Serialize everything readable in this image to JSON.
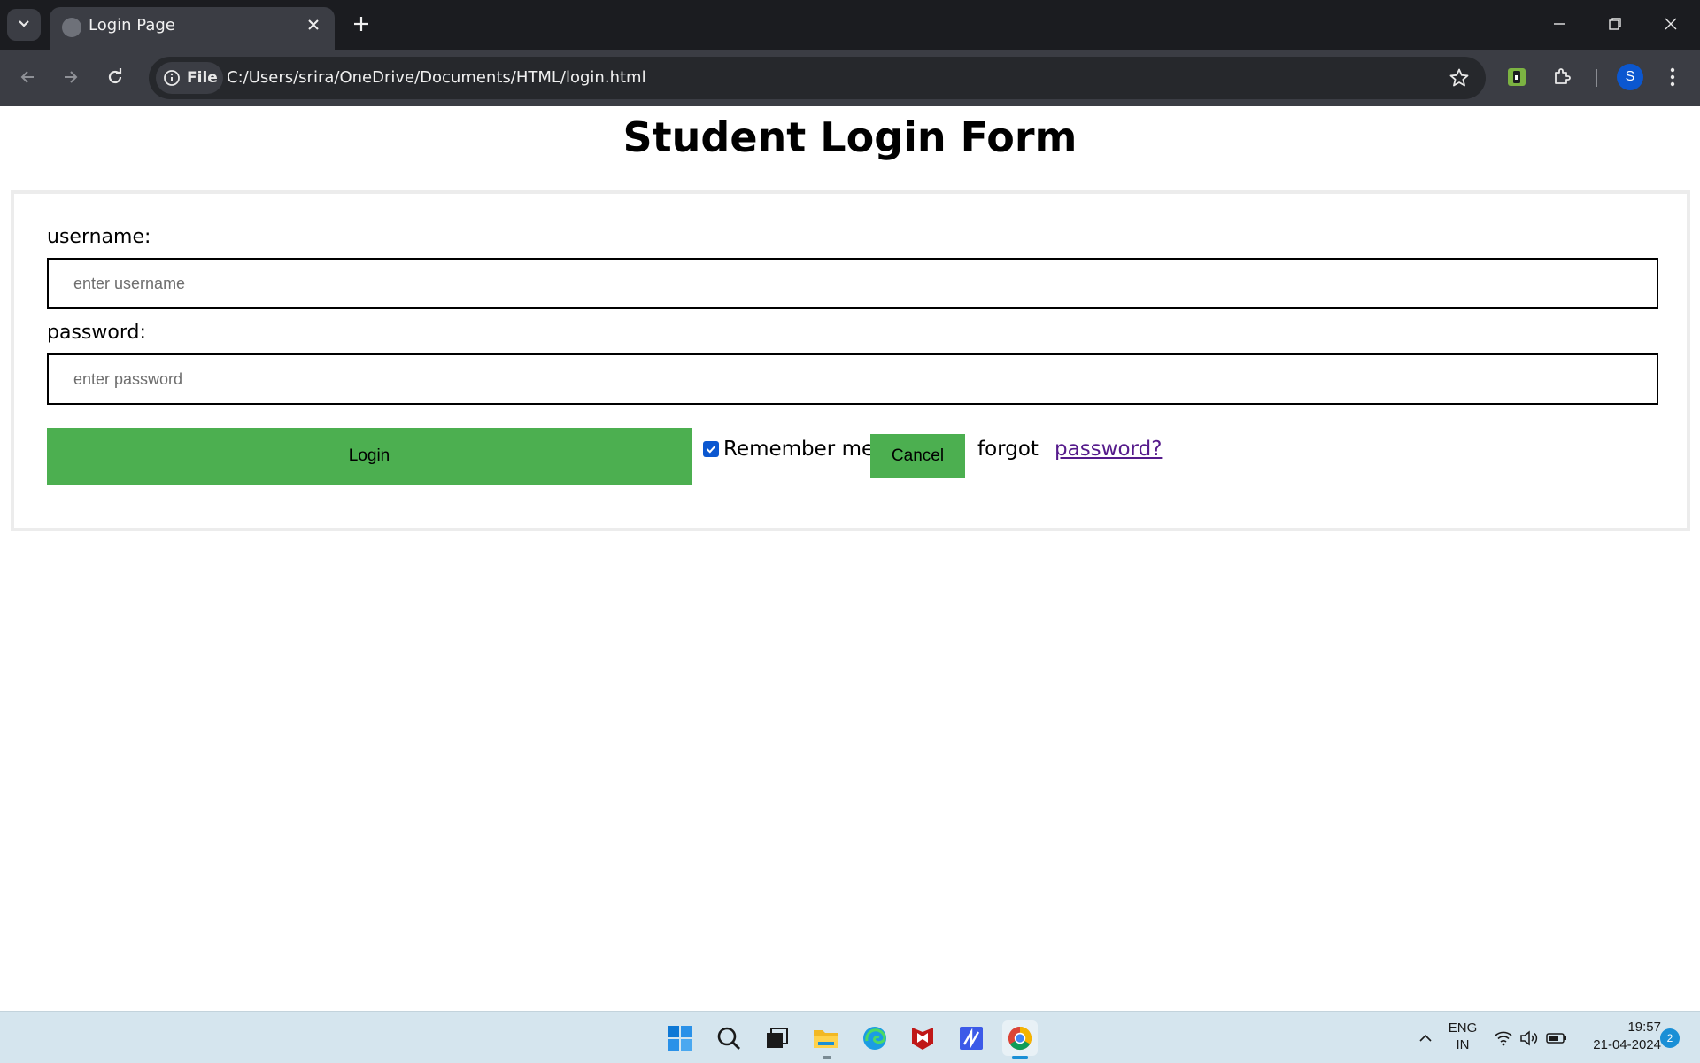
{
  "browser": {
    "tab_title": "Login Page",
    "site_chip_label": "File",
    "url": "C:/Users/srira/OneDrive/Documents/HTML/login.html",
    "profile_initial": "S"
  },
  "page": {
    "heading": "Student Login Form",
    "username_label": "username:",
    "username_placeholder": "enter username",
    "username_value": "",
    "password_label": "password:",
    "password_placeholder": "enter password",
    "password_value": "",
    "login_button": "Login",
    "remember_checked": true,
    "remember_label": "Remember me",
    "cancel_button": "Cancel",
    "forgot_text": "forgot",
    "forgot_link": "password?",
    "button_color": "#4caf50",
    "link_color": "#551a8b"
  },
  "taskbar": {
    "language_line1": "ENG",
    "language_line2": "IN",
    "time": "19:57",
    "date": "21-04-2024",
    "notification_count": "2",
    "apps": [
      "start-icon",
      "search-icon",
      "task-view-icon",
      "file-explorer-icon",
      "edge-icon",
      "mcafee-icon",
      "app-icon",
      "chrome-icon"
    ]
  }
}
